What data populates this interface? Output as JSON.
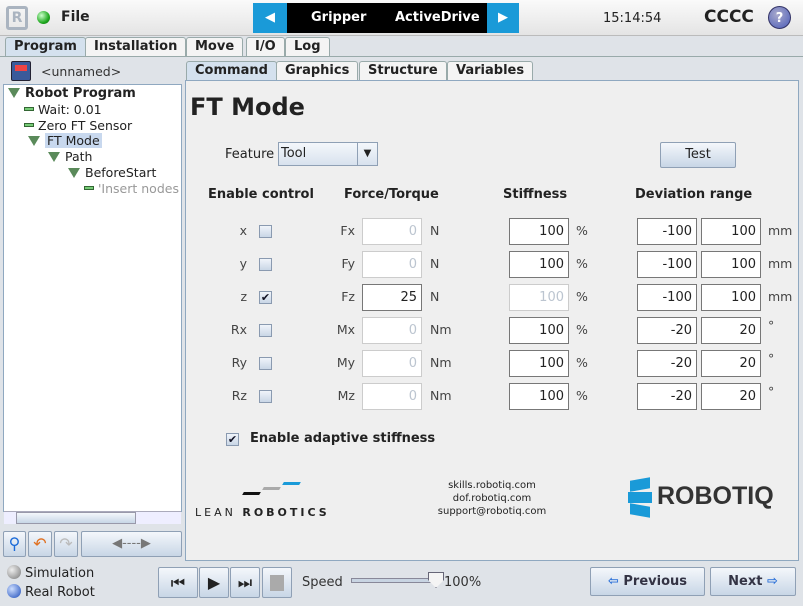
{
  "header": {
    "menu": "File",
    "prev_program": "Gripper",
    "next_program": "ActiveDrive",
    "time": "15:14:54",
    "robot_name": "CCCC",
    "accent": "#1a9ad8"
  },
  "main_tabs": [
    "Program",
    "Installation",
    "Move",
    "I/O",
    "Log"
  ],
  "program_name": "<unnamed>",
  "tree": [
    {
      "label": "Robot Program"
    },
    {
      "label": "Wait: 0.01"
    },
    {
      "label": "Zero FT Sensor"
    },
    {
      "label": "FT Mode"
    },
    {
      "label": "Path"
    },
    {
      "label": "BeforeStart"
    },
    {
      "label": "'Insert nodes"
    }
  ],
  "sub_tabs": [
    "Command",
    "Graphics",
    "Structure",
    "Variables"
  ],
  "title": "FT Mode",
  "feature": {
    "label": "Feature",
    "value": "Tool"
  },
  "test_label": "Test",
  "headers": {
    "enable": "Enable control",
    "force": "Force/Torque",
    "stiffness": "Stiffness",
    "deviation": "Deviation range"
  },
  "rows": [
    {
      "axis": "x",
      "checked": false,
      "f": "Fx",
      "fval": "0",
      "funit": "N",
      "fen": false,
      "stiff": "100",
      "sen": true,
      "min": "-100",
      "max": "100",
      "dunit": "mm"
    },
    {
      "axis": "y",
      "checked": false,
      "f": "Fy",
      "fval": "0",
      "funit": "N",
      "fen": false,
      "stiff": "100",
      "sen": true,
      "min": "-100",
      "max": "100",
      "dunit": "mm"
    },
    {
      "axis": "z",
      "checked": true,
      "f": "Fz",
      "fval": "25",
      "funit": "N",
      "fen": true,
      "stiff": "100",
      "sen": false,
      "min": "-100",
      "max": "100",
      "dunit": "mm"
    },
    {
      "axis": "Rx",
      "checked": false,
      "f": "Mx",
      "fval": "0",
      "funit": "Nm",
      "fen": false,
      "stiff": "100",
      "sen": true,
      "min": "-20",
      "max": "20",
      "dunit": "°"
    },
    {
      "axis": "Ry",
      "checked": false,
      "f": "My",
      "fval": "0",
      "funit": "Nm",
      "fen": false,
      "stiff": "100",
      "sen": true,
      "min": "-20",
      "max": "20",
      "dunit": "°"
    },
    {
      "axis": "Rz",
      "checked": false,
      "f": "Mz",
      "fval": "0",
      "funit": "Nm",
      "fen": false,
      "stiff": "100",
      "sen": true,
      "min": "-20",
      "max": "20",
      "dunit": "°"
    }
  ],
  "stiff_unit": "%",
  "adaptive": {
    "label": "Enable adaptive stiffness",
    "checked": true
  },
  "footer": {
    "lean": "LEAN",
    "robotics": "ROBOTICS",
    "links": [
      "skills.robotiq.com",
      "dof.robotiq.com",
      "support@robotiq.com"
    ],
    "logo": "ROBOTIQ"
  },
  "bottom": {
    "simulation": "Simulation",
    "real": "Real Robot",
    "speed_label": "Speed",
    "speed": "100%",
    "speed_value": 100,
    "previous": "Previous",
    "next": "Next"
  }
}
